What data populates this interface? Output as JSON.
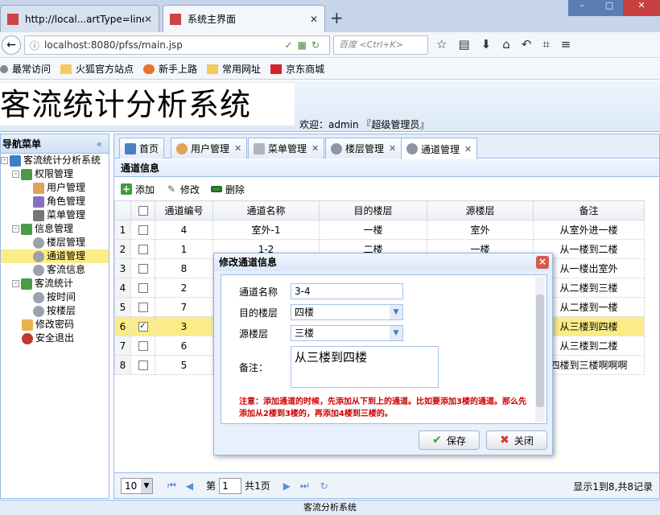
{
  "browser": {
    "tabs": [
      {
        "title": "http://local...artType=line"
      },
      {
        "title": "系统主界面"
      }
    ],
    "url": "localhost:8080/pfss/main.jsp",
    "search_placeholder": "百度 <Ctrl+K>",
    "bookmarks": [
      "最常访问",
      "火狐官方站点",
      "新手上路",
      "常用网址",
      "京东商城"
    ]
  },
  "app": {
    "title": "客流统计分析系统",
    "welcome": "欢迎：admin 『超级管理员』",
    "status_bar": "客流分析系统"
  },
  "sidebar": {
    "title": "导航菜单",
    "tree": [
      {
        "label": "客流统计分析系统",
        "level": 0,
        "toggle": "-"
      },
      {
        "label": "权限管理",
        "level": 1,
        "toggle": "-"
      },
      {
        "label": "用户管理",
        "level": 2
      },
      {
        "label": "角色管理",
        "level": 2
      },
      {
        "label": "菜单管理",
        "level": 2
      },
      {
        "label": "信息管理",
        "level": 1,
        "toggle": "-"
      },
      {
        "label": "楼层管理",
        "level": 2
      },
      {
        "label": "通道管理",
        "level": 2,
        "selected": true
      },
      {
        "label": "客流信息",
        "level": 2
      },
      {
        "label": "客流统计",
        "level": 1,
        "toggle": "-"
      },
      {
        "label": "按时间",
        "level": 2
      },
      {
        "label": "按楼层",
        "level": 2
      },
      {
        "label": "修改密码",
        "level": 1
      },
      {
        "label": "安全退出",
        "level": 1
      }
    ]
  },
  "main": {
    "tabs": [
      {
        "label": "首页"
      },
      {
        "label": "用户管理"
      },
      {
        "label": "菜单管理"
      },
      {
        "label": "楼层管理"
      },
      {
        "label": "通道管理"
      }
    ],
    "panel_title": "通道信息",
    "toolbar": {
      "add": "添加",
      "edit": "修改",
      "delete": "删除"
    },
    "columns": [
      "通道编号",
      "通道名称",
      "目的楼层",
      "源楼层",
      "备注"
    ],
    "rows": [
      {
        "n": "1",
        "id": "4",
        "name": "室外-1",
        "dest": "一楼",
        "src": "室外",
        "note": "从室外进一楼",
        "checked": false
      },
      {
        "n": "2",
        "id": "1",
        "name": "1-2",
        "dest": "二楼",
        "src": "一楼",
        "note": "从一楼到二楼",
        "checked": false
      },
      {
        "n": "3",
        "id": "8",
        "name": "",
        "dest": "",
        "src": "",
        "note": "从一楼出室外",
        "checked": false
      },
      {
        "n": "4",
        "id": "2",
        "name": "",
        "dest": "",
        "src": "",
        "note": "从二楼到三楼",
        "checked": false
      },
      {
        "n": "5",
        "id": "7",
        "name": "",
        "dest": "",
        "src": "",
        "note": "从二楼到一楼",
        "checked": false
      },
      {
        "n": "6",
        "id": "3",
        "name": "",
        "dest": "",
        "src": "",
        "note": "从三楼到四楼",
        "checked": true
      },
      {
        "n": "7",
        "id": "6",
        "name": "",
        "dest": "",
        "src": "",
        "note": "从三楼到二楼",
        "checked": false
      },
      {
        "n": "8",
        "id": "5",
        "name": "",
        "dest": "",
        "src": "",
        "note": "四楼到三楼啊啊啊",
        "checked": false
      }
    ],
    "pager": {
      "page_size": "10",
      "page_prefix": "第",
      "page": "1",
      "page_total": "共1页",
      "info": "显示1到8,共8记录"
    }
  },
  "dialog": {
    "title": "修改通道信息",
    "fields": {
      "name_label": "通道名称",
      "name_value": "3-4",
      "dest_label": "目的楼层",
      "dest_value": "四楼",
      "src_label": "源楼层",
      "src_value": "三楼",
      "note_label": "备注：",
      "note_value": "从三楼到四楼"
    },
    "notice": "注意：添加通道的时候，先添加从下到上的通道。比如要添加3楼的通道。那么先添加从2楼到3楼的，再添加4楼到三楼的。",
    "save": "保存",
    "close": "关闭"
  },
  "colors": {
    "accent": "#99bbe8",
    "selected_row": "#fbec88",
    "notice": "#cc0000"
  }
}
